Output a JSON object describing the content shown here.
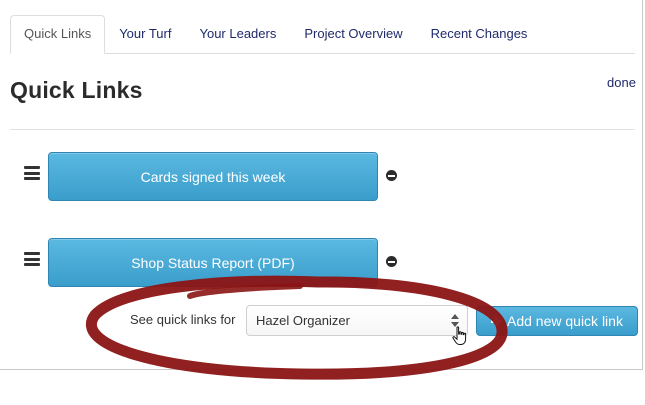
{
  "tabs": [
    {
      "label": "Quick Links",
      "active": true
    },
    {
      "label": "Your Turf",
      "active": false
    },
    {
      "label": "Your Leaders",
      "active": false
    },
    {
      "label": "Project Overview",
      "active": false
    },
    {
      "label": "Recent Changes",
      "active": false
    }
  ],
  "page": {
    "title": "Quick Links",
    "done_label": "done"
  },
  "quick_links": [
    {
      "label": "Cards signed this week",
      "drag_icon": "menu-icon",
      "remove_icon": "minus-circle-icon"
    },
    {
      "label": "Shop Status Report (PDF)",
      "drag_icon": "menu-icon",
      "remove_icon": "minus-circle-icon"
    }
  ],
  "controls": {
    "see_label": "See quick links for",
    "select_value": "Hazel Organizer",
    "add_button_label": "Add new quick link",
    "add_icon": "plus-icon"
  },
  "colors": {
    "button_blue": "#3a9dcb",
    "link_navy": "#1f2a6b",
    "annotation_red": "#8b1414"
  }
}
